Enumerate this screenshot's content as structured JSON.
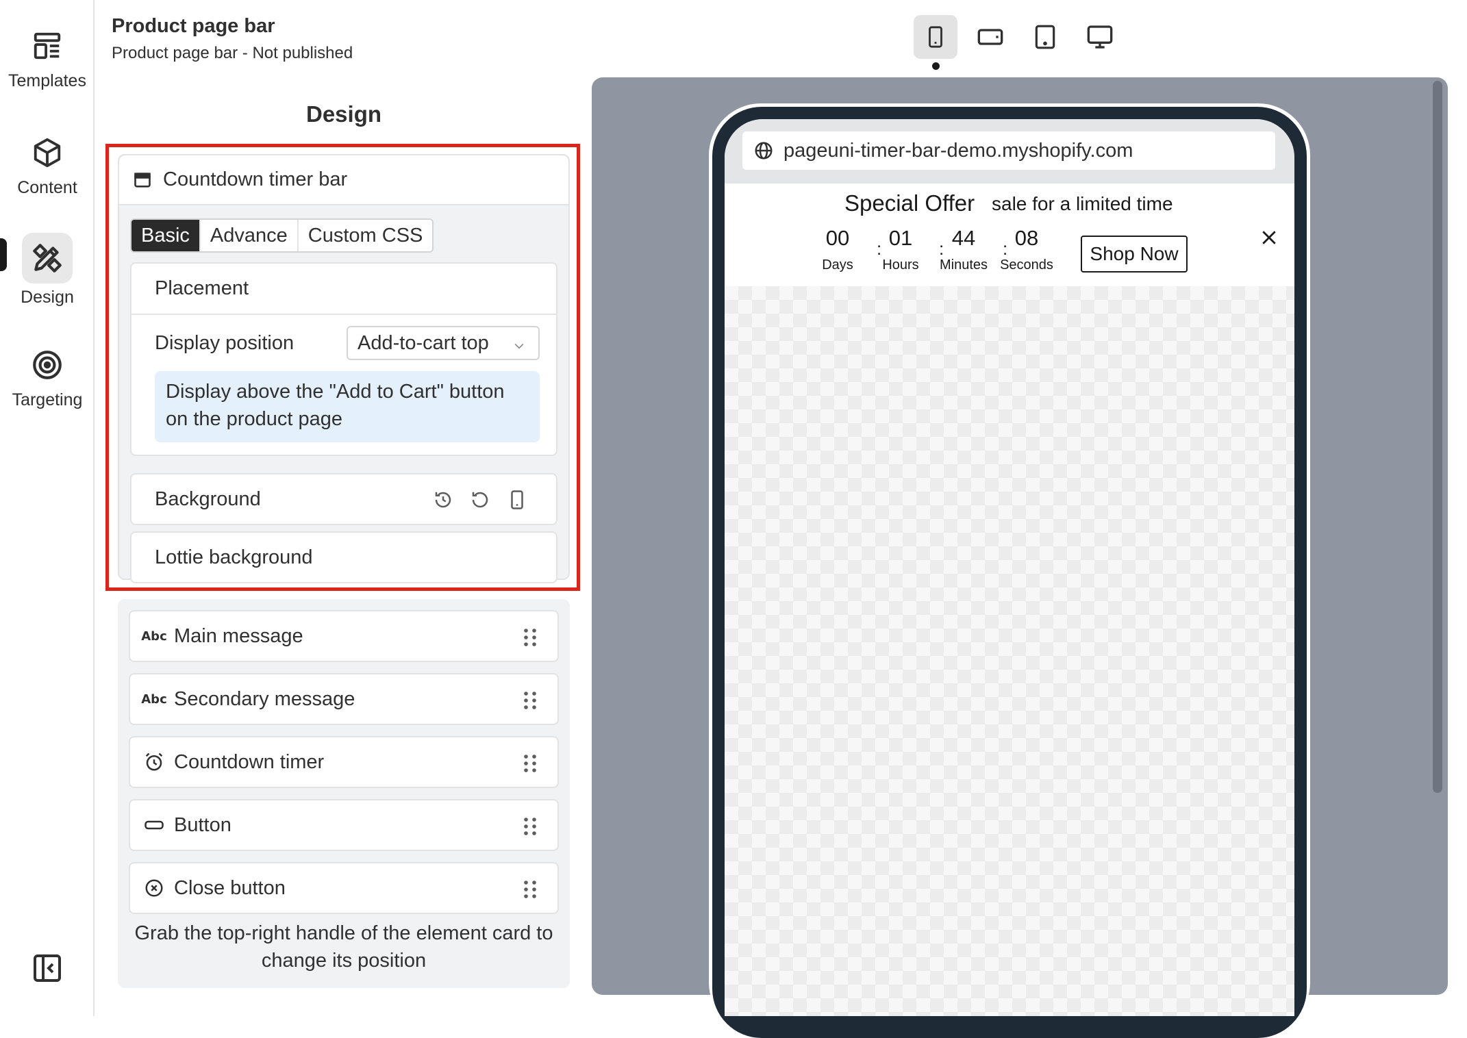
{
  "header": {
    "title": "Product page bar",
    "subtitle": "Product page bar - Not published"
  },
  "rail": {
    "items": [
      {
        "label": "Templates",
        "icon": "templates-icon"
      },
      {
        "label": "Content",
        "icon": "cube-icon"
      },
      {
        "label": "Design",
        "icon": "design-tools-icon"
      },
      {
        "label": "Targeting",
        "icon": "target-icon"
      }
    ],
    "active": "Design"
  },
  "devices": [
    "mobile",
    "mobile-landscape",
    "tablet",
    "desktop"
  ],
  "design": {
    "title": "Design",
    "card_title": "Countdown timer bar",
    "tabs": [
      "Basic",
      "Advance",
      "Custom CSS"
    ],
    "active_tab": "Basic",
    "placement": {
      "title": "Placement",
      "display_position_label": "Display position",
      "display_position_value": "Add-to-cart top",
      "info": "Display above the \"Add to Cart\" button on the product page"
    },
    "background_label": "Background",
    "lottie_label": "Lottie background"
  },
  "elements": [
    {
      "label": "Main message",
      "icon": "text-abc-icon"
    },
    {
      "label": "Secondary message",
      "icon": "text-abc-icon"
    },
    {
      "label": "Countdown timer",
      "icon": "alarm-clock-icon"
    },
    {
      "label": "Button",
      "icon": "button-icon"
    },
    {
      "label": "Close button",
      "icon": "close-circle-icon"
    }
  ],
  "hint": "Grab the top-right handle of the element card to change its position",
  "preview": {
    "url": "pageuni-timer-bar-demo.myshopify.com",
    "main_message": "Special Offer",
    "secondary_message": "sale for a limited time",
    "timer": {
      "days": "00",
      "hours": "01",
      "minutes": "44",
      "seconds": "08",
      "days_label": "Days",
      "hours_label": "Hours",
      "minutes_label": "Minutes",
      "seconds_label": "Seconds",
      "separator": ":"
    },
    "button_label": "Shop Now"
  },
  "colors": {
    "highlight": "#d9261c",
    "active_tab": "#2a2a2a",
    "info_bg": "#e4f0fc",
    "preview_bg": "#8f95a1",
    "phone_frame": "#1f2a37"
  }
}
